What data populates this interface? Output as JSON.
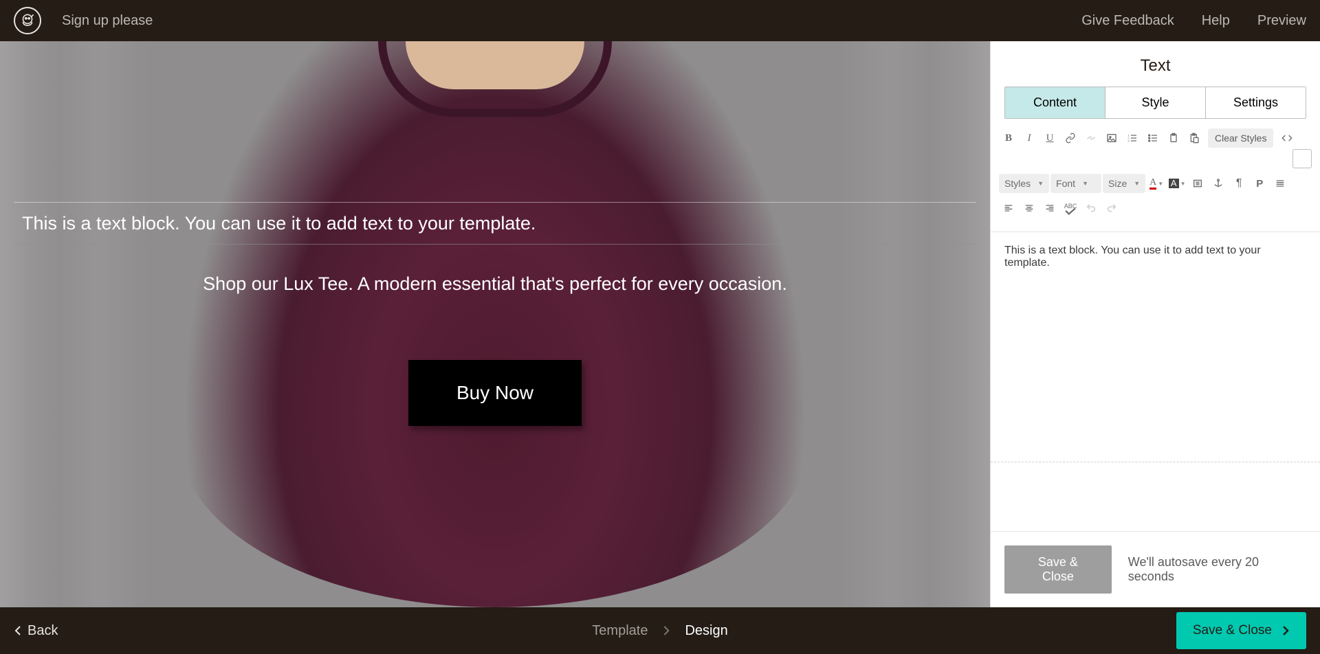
{
  "topbar": {
    "title": "Sign up please",
    "feedback": "Give Feedback",
    "help": "Help",
    "preview": "Preview"
  },
  "canvas": {
    "text_block": "This is a text block. You can use it to add text to your template.",
    "subtitle": "Shop our Lux Tee. A modern essential that's perfect for every occasion.",
    "buy_label": "Buy Now"
  },
  "panel": {
    "title": "Text",
    "tabs": {
      "content": "Content",
      "style": "Style",
      "settings": "Settings"
    },
    "toolbar": {
      "clear_styles": "Clear Styles",
      "styles_drop": "Styles",
      "font_drop": "Font",
      "size_drop": "Size"
    },
    "editor_text": "This is a text block. You can use it to add text to your template.",
    "save_close": "Save & Close",
    "autosave": "We'll autosave every 20 seconds"
  },
  "bottombar": {
    "back": "Back",
    "crumb1": "Template",
    "crumb2": "Design",
    "save_close": "Save & Close"
  }
}
